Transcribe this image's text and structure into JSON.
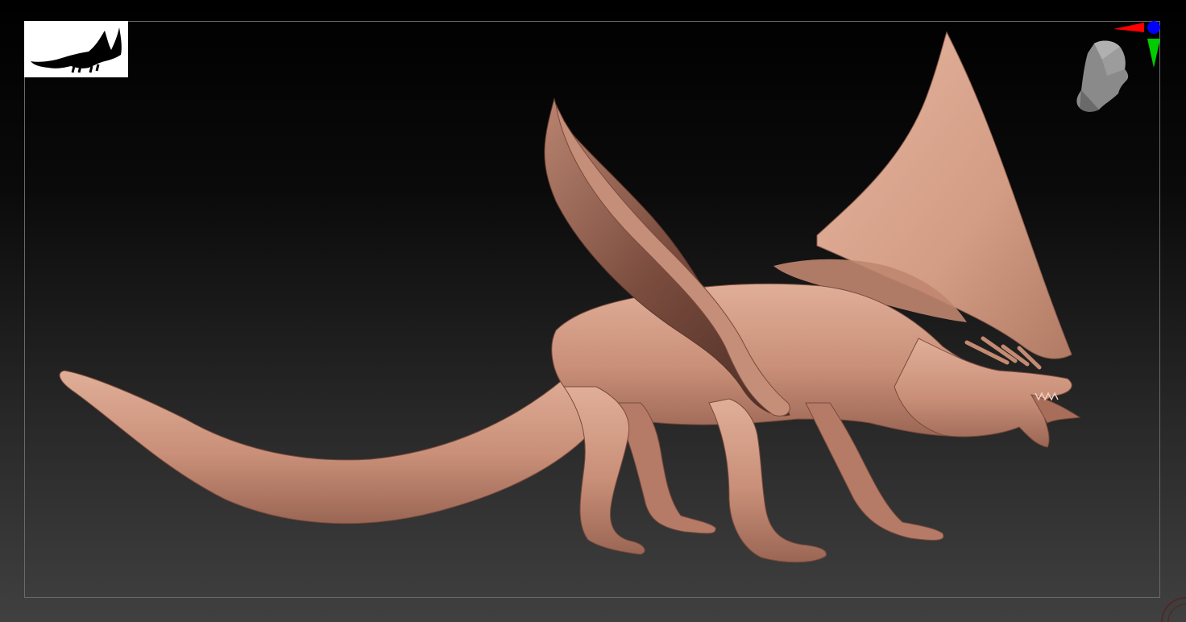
{
  "viewport": {
    "background_top": "#000000",
    "background_bottom": "#404040",
    "frame_color": "#6a6a6a"
  },
  "model": {
    "subject": "dragon-sculpt",
    "clay_color": "#c98f78",
    "clay_shadow": "#8a5a4a",
    "clay_highlight": "#e2b29c"
  },
  "navigation": {
    "gizmo_axes": [
      "x-axis-red",
      "y-axis-green",
      "z-axis-blue"
    ],
    "axis_colors": {
      "x": "#ff0000",
      "y": "#00cc00",
      "z": "#0000ff"
    },
    "head_icon": "mannequin-head-icon"
  },
  "thumbnail": {
    "icon": "dragon-silhouette-icon"
  }
}
